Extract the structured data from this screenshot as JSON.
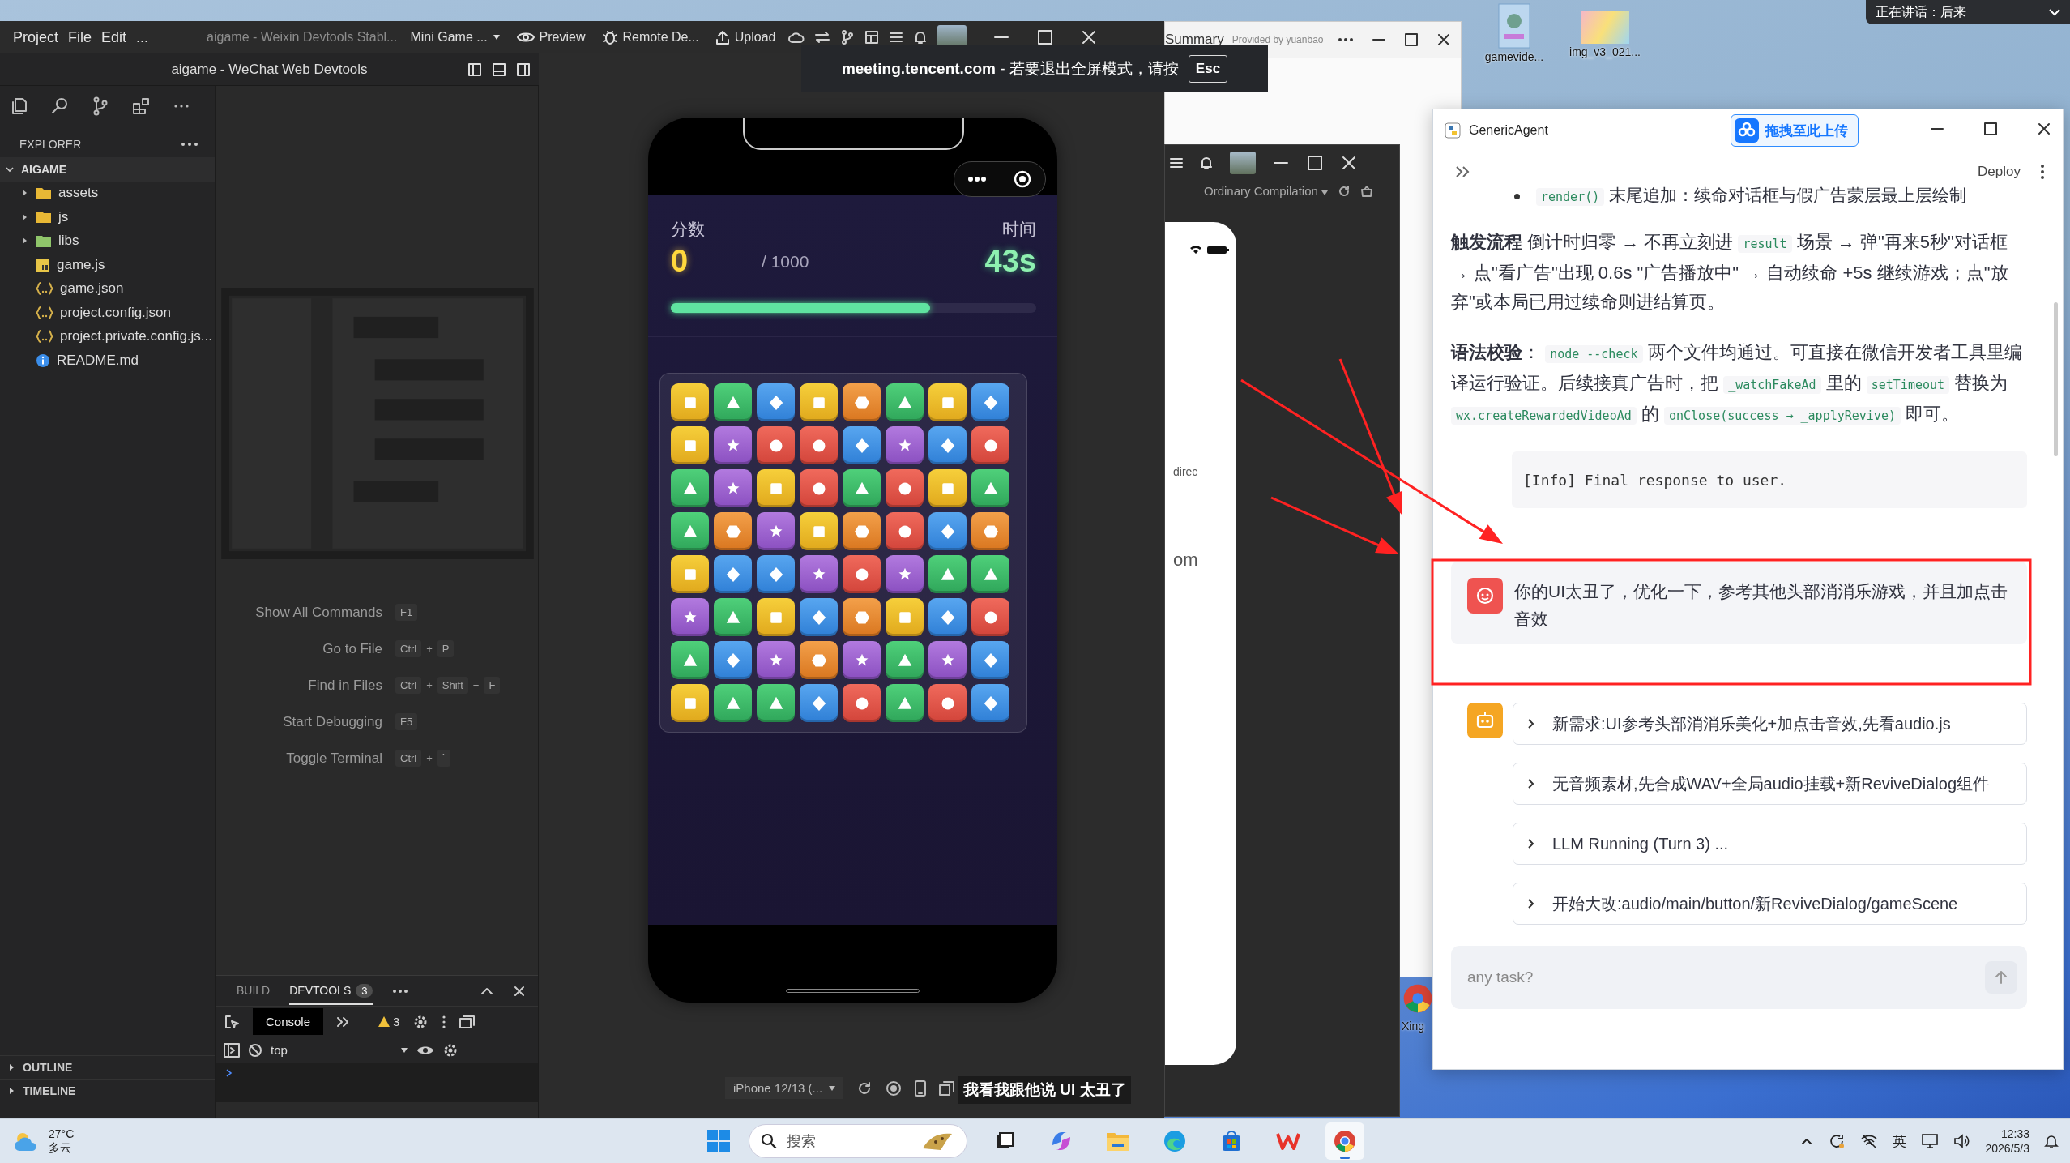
{
  "devtools": {
    "menus": [
      "Project",
      "File",
      "Edit",
      "..."
    ],
    "title": "aigame - Weixin Devtools Stabl...",
    "mode": "Mini Game ...",
    "toolbar": [
      {
        "label": "Preview",
        "kind": "eye"
      },
      {
        "label": "Remote De...",
        "kind": "bug"
      },
      {
        "label": "Upload",
        "kind": "upload"
      }
    ],
    "subtitle": "aigame - WeChat Web Devtools",
    "explorer": {
      "title": "EXPLORER",
      "root": {
        "name": "AIGAME",
        "expanded": true,
        "children": [
          {
            "name": "assets",
            "kind": "folder",
            "expanded": false
          },
          {
            "name": "js",
            "kind": "folder",
            "expanded": false
          },
          {
            "name": "libs",
            "kind": "lib-folder",
            "expanded": false
          },
          {
            "name": "game.js",
            "kind": "js"
          },
          {
            "name": "game.json",
            "kind": "json"
          },
          {
            "name": "project.config.json",
            "kind": "json"
          },
          {
            "name": "project.private.config.js...",
            "kind": "json"
          },
          {
            "name": "README.md",
            "kind": "info"
          }
        ]
      }
    },
    "sections": [
      {
        "name": "OUTLINE",
        "expanded": false
      },
      {
        "name": "TIMELINE",
        "expanded": false
      }
    ],
    "key_joiner": "+",
    "commands": [
      {
        "label": "Show All Commands",
        "keys": [
          "F1"
        ]
      },
      {
        "label": "Go to File",
        "keys": [
          "Ctrl",
          "P"
        ]
      },
      {
        "label": "Find in Files",
        "keys": [
          "Ctrl",
          "Shift",
          "F"
        ]
      },
      {
        "label": "Start Debugging",
        "keys": [
          "F5"
        ]
      },
      {
        "label": "Toggle Terminal",
        "keys": [
          "Ctrl",
          "`"
        ]
      }
    ],
    "panel": {
      "tabs": [
        {
          "label": "BUILD",
          "selected": false
        },
        {
          "label": "DEVTOOLS",
          "selected": true,
          "badge": "3"
        }
      ],
      "console_tab": "Console",
      "warnings": "3",
      "context": "top"
    },
    "device": "iPhone 12/13 (..."
  },
  "game": {
    "score_label": "分数",
    "score": "0",
    "target": "/ 1000",
    "time_label": "时间",
    "time": "43s",
    "level": 0.71,
    "board": [
      [
        {
          "kind": "square"
        },
        {
          "kind": "triangle"
        },
        {
          "kind": "diamond"
        },
        {
          "kind": "square"
        },
        {
          "kind": "hexagon"
        },
        {
          "kind": "triangle"
        },
        {
          "kind": "square"
        },
        {
          "kind": "diamond"
        }
      ],
      [
        {
          "kind": "square"
        },
        {
          "kind": "star"
        },
        {
          "kind": "circle"
        },
        {
          "kind": "circle"
        },
        {
          "kind": "diamond"
        },
        {
          "kind": "star"
        },
        {
          "kind": "diamond"
        },
        {
          "kind": "circle"
        }
      ],
      [
        {
          "kind": "triangle"
        },
        {
          "kind": "star"
        },
        {
          "kind": "square"
        },
        {
          "kind": "circle"
        },
        {
          "kind": "triangle"
        },
        {
          "kind": "circle"
        },
        {
          "kind": "square"
        },
        {
          "kind": "triangle"
        }
      ],
      [
        {
          "kind": "triangle"
        },
        {
          "kind": "hexagon"
        },
        {
          "kind": "star"
        },
        {
          "kind": "square"
        },
        {
          "kind": "hexagon"
        },
        {
          "kind": "circle"
        },
        {
          "kind": "diamond"
        },
        {
          "kind": "hexagon"
        }
      ],
      [
        {
          "kind": "square"
        },
        {
          "kind": "diamond"
        },
        {
          "kind": "diamond"
        },
        {
          "kind": "star"
        },
        {
          "kind": "circle"
        },
        {
          "kind": "star"
        },
        {
          "kind": "triangle"
        },
        {
          "kind": "triangle"
        }
      ],
      [
        {
          "kind": "star"
        },
        {
          "kind": "triangle"
        },
        {
          "kind": "square"
        },
        {
          "kind": "diamond"
        },
        {
          "kind": "hexagon"
        },
        {
          "kind": "square"
        },
        {
          "kind": "diamond"
        },
        {
          "kind": "circle"
        }
      ],
      [
        {
          "kind": "triangle"
        },
        {
          "kind": "diamond"
        },
        {
          "kind": "star"
        },
        {
          "kind": "hexagon"
        },
        {
          "kind": "star"
        },
        {
          "kind": "triangle"
        },
        {
          "kind": "star"
        },
        {
          "kind": "diamond"
        }
      ],
      [
        {
          "kind": "square"
        },
        {
          "kind": "triangle"
        },
        {
          "kind": "triangle"
        },
        {
          "kind": "diamond"
        },
        {
          "kind": "circle"
        },
        {
          "kind": "triangle"
        },
        {
          "kind": "circle"
        },
        {
          "kind": "diamond"
        }
      ]
    ]
  },
  "meeting": {
    "site": "meeting.tencent.com",
    "message": "- 若要退出全屏模式，请按",
    "key": "Esc",
    "speaker": "正在讲话：后来"
  },
  "summary": {
    "title": "Summary",
    "provider": "Provided by yuanbao"
  },
  "simulator2": {
    "compile": "Ordinary Compilation",
    "texts": [
      "direc",
      "om"
    ]
  },
  "desktop_icons": [
    {
      "label": "gamevide...",
      "kind": "poster"
    },
    {
      "label": "img_v3_021...",
      "kind": "photo"
    }
  ],
  "side_icon": {
    "label": "Xing"
  },
  "agent": {
    "title": "GenericAgent",
    "upload": "拖拽至此上传",
    "deploy": "Deploy",
    "blocks": [
      {
        "kind": "bullet",
        "parts": [
          {
            "kind": "code",
            "text": "render()"
          },
          {
            "kind": "text",
            "text": " 末尾追加：续命对话框与假广告蒙层最上层绘制"
          }
        ]
      },
      {
        "kind": "paragraph",
        "parts": [
          {
            "kind": "bold",
            "text": "触发流程"
          },
          {
            "kind": "text",
            "text": " 倒计时归零 → 不再立刻进 "
          },
          {
            "kind": "code",
            "text": "result"
          },
          {
            "kind": "text",
            "text": " 场景 → 弹\"再来5秒\"对话框 → 点\"看广告\"出现 0.6s \"广告播放中\" → 自动续命 +5s 继续游戏；点\"放弃\"或本局已用过续命则进结算页。"
          }
        ]
      },
      {
        "kind": "paragraph",
        "parts": [
          {
            "kind": "bold",
            "text": "语法校验"
          },
          {
            "kind": "text",
            "text": "： "
          },
          {
            "kind": "code",
            "text": "node --check"
          },
          {
            "kind": "text",
            "text": " 两个文件均通过。可直接在微信开发者工具里编译运行验证。后续接真广告时，把 "
          },
          {
            "kind": "code",
            "text": "_watchFakeAd"
          },
          {
            "kind": "text",
            "text": " 里的 "
          },
          {
            "kind": "code",
            "text": "setTimeout"
          },
          {
            "kind": "text",
            "text": " 替换为 "
          },
          {
            "kind": "code",
            "text": "wx.createRewardedVideoAd"
          },
          {
            "kind": "text",
            "text": " 的 "
          },
          {
            "kind": "code",
            "text": "onClose(success → _applyRevive)"
          },
          {
            "kind": "text",
            "text": " 即可。"
          }
        ]
      },
      {
        "kind": "codeblock",
        "text": "[Info] Final response to user."
      }
    ],
    "user_message": "你的UI太丑了，优化一下，参考其他头部消消乐游戏，并且加点击音效",
    "steps": [
      {
        "label": "新需求:UI参考头部消消乐美化+加点击音效,先看audio.js",
        "expanded": false
      },
      {
        "label": "无音频素材,先合成WAV+全局audio挂载+新ReviveDialog组件",
        "expanded": false
      },
      {
        "label": "LLM Running (Turn 3) ...",
        "expanded": false
      },
      {
        "label": "开始大改:audio/main/button/新ReviveDialog/gameScene",
        "expanded": false
      }
    ],
    "placeholder": "any task?"
  },
  "subtitle": "我看我跟他说 UI 太丑了",
  "taskbar": {
    "temperature": "27°C",
    "weather": "多云",
    "search": "搜索",
    "apps": [
      {
        "kind": "taskview",
        "selected": false
      },
      {
        "kind": "copilot",
        "selected": false
      },
      {
        "kind": "files",
        "selected": false
      },
      {
        "kind": "edge",
        "selected": false
      },
      {
        "kind": "store",
        "selected": false
      },
      {
        "kind": "wps",
        "selected": false
      },
      {
        "kind": "chrome",
        "selected": true
      }
    ],
    "ime": "英",
    "time": "12:33",
    "date": "2026/5/3"
  }
}
